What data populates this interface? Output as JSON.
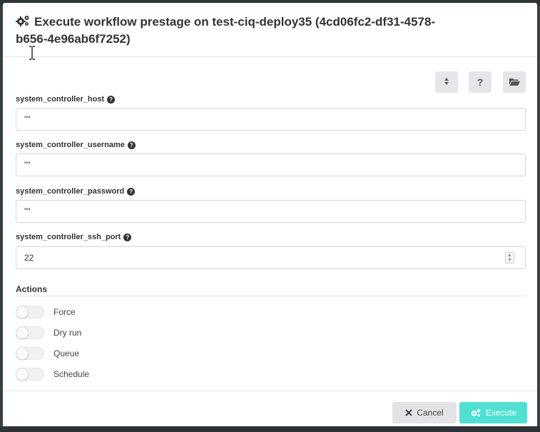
{
  "dialog": {
    "title": "Execute workflow prestage on test-ciq-deploy35 (4cd06fc2-df31-4578-b656-4e96ab6f7252)"
  },
  "toolbar": {
    "sort_icon": "sort-icon",
    "help_label": "?",
    "folder_icon": "folder-open-icon"
  },
  "fields": [
    {
      "label": "system_controller_host",
      "value": "\"\""
    },
    {
      "label": "system_controller_username",
      "value": "\"\""
    },
    {
      "label": "system_controller_password",
      "value": "\"\""
    },
    {
      "label": "system_controller_ssh_port",
      "value": "22"
    }
  ],
  "actions": {
    "title": "Actions",
    "toggles": [
      {
        "label": "Force",
        "checked": false
      },
      {
        "label": "Dry run",
        "checked": false
      },
      {
        "label": "Queue",
        "checked": false
      },
      {
        "label": "Schedule",
        "checked": false
      }
    ]
  },
  "footer": {
    "cancel_label": "Cancel",
    "execute_label": "Execute"
  },
  "colors": {
    "execute_accent": "#4fe0d2",
    "cancel_bg": "#e1e3e6",
    "toolbar_bg": "#e4e6e9"
  }
}
